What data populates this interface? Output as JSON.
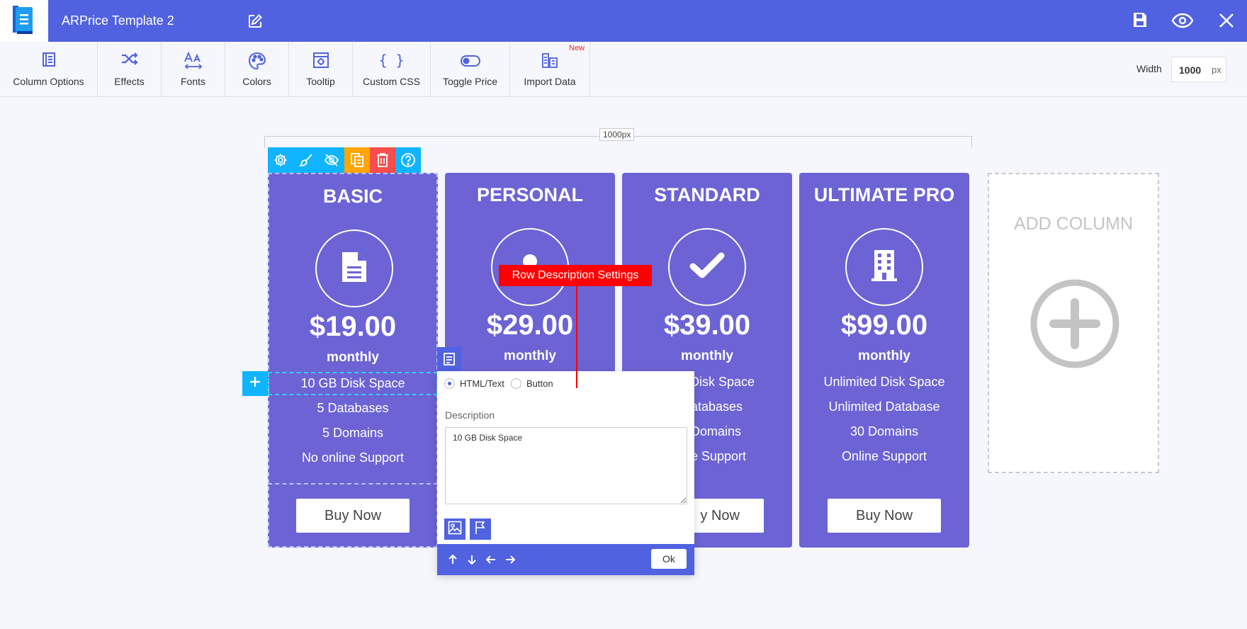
{
  "app": {
    "title": "ARPrice Template 2"
  },
  "toolbar": {
    "items": [
      {
        "label": "Column Options",
        "icon": "column-options-icon"
      },
      {
        "label": "Effects",
        "icon": "shuffle-icon"
      },
      {
        "label": "Fonts",
        "icon": "fonts-icon"
      },
      {
        "label": "Colors",
        "icon": "palette-icon"
      },
      {
        "label": "Tooltip",
        "icon": "tooltip-icon"
      },
      {
        "label": "Custom CSS",
        "icon": "braces-icon"
      },
      {
        "label": "Toggle Price",
        "icon": "toggle-icon"
      },
      {
        "label": "Import Data",
        "icon": "import-data-icon"
      }
    ],
    "new_badge": "New",
    "width_label": "Width",
    "width_value": "1000",
    "width_unit": "px"
  },
  "ruler": {
    "label": "1000px"
  },
  "columns": [
    {
      "title": "BASIC",
      "icon": "document-icon",
      "price": "$19.00",
      "period": "monthly",
      "rows": [
        "10 GB Disk Space",
        "5 Databases",
        "5 Domains",
        "No online Support"
      ],
      "button": "Buy Now"
    },
    {
      "title": "PERSONAL",
      "icon": "user-icon",
      "price": "$29.00",
      "period": "monthly",
      "rows": [],
      "button": ""
    },
    {
      "title": "STANDARD",
      "icon": "checkmark-icon",
      "price": "$39.00",
      "period": "monthly",
      "rows": [
        " Disk Space",
        "atabases",
        "Domains",
        "e Support"
      ],
      "button": "y Now"
    },
    {
      "title": "ULTIMATE PRO",
      "icon": "building-icon",
      "price": "$99.00",
      "period": "monthly",
      "rows": [
        "Unlimited Disk Space",
        "Unlimited Database",
        "30 Domains",
        "Online Support"
      ],
      "button": "Buy Now"
    }
  ],
  "add_column": {
    "label": "ADD COLUMN"
  },
  "popup": {
    "options": [
      "HTML/Text",
      "Button"
    ],
    "selected_option": "HTML/Text",
    "description_label": "Description",
    "description_value": "10 GB Disk Space",
    "ok_label": "Ok"
  },
  "annotation": {
    "label": "Row Description Settings"
  },
  "colors": {
    "accent": "#5062e0",
    "column_bg": "#6c63d5",
    "cyan": "#10b4ff",
    "annotation": "#fe0000"
  }
}
